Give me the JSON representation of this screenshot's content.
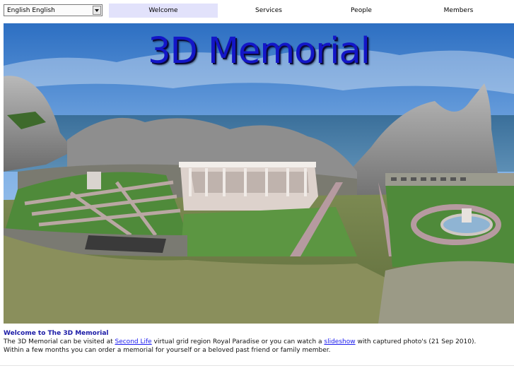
{
  "language": {
    "selected": "English English"
  },
  "nav": {
    "tabs": [
      "Welcome",
      "Services",
      "People",
      "Members"
    ]
  },
  "banner": {
    "title": "3D Memorial"
  },
  "content": {
    "heading": "Welcome to The 3D Memorial",
    "line1_before": "The 3D Memorial can be visited at ",
    "line1_link1": "Second Life",
    "line1_middle": " virtual grid region Royal Paradise or you can watch a ",
    "line1_link2": "slideshow",
    "line1_after": " with captured photo's (21 Sep 2010).",
    "line2": "Within a few months you can order a memorial for yourself or a beloved past friend or family member."
  },
  "colors": {
    "accent": "#1316c8",
    "active_tab": "#e2e2fb",
    "link": "#1a1aee"
  }
}
